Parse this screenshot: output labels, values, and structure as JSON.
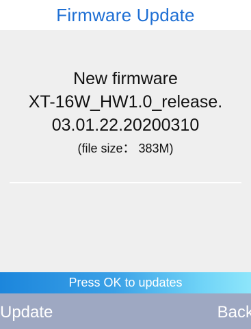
{
  "header": {
    "title": "Firmware Update"
  },
  "firmware": {
    "heading": "New firmware",
    "name_line1": "XT-16W_HW1.0_release.",
    "name_line2": "03.01.22.20200310",
    "file_size": "(file size： 383M)"
  },
  "hint": {
    "text": "Press OK to updates"
  },
  "softkeys": {
    "left_label": "Update",
    "right_label": "Back"
  },
  "colors": {
    "title": "#1e6fd4",
    "content_bg": "#efefef",
    "hint_bar_start": "#1c86dc",
    "hint_bar_end": "#8ee6fb",
    "softkey_bar": "#9ea8c2"
  }
}
